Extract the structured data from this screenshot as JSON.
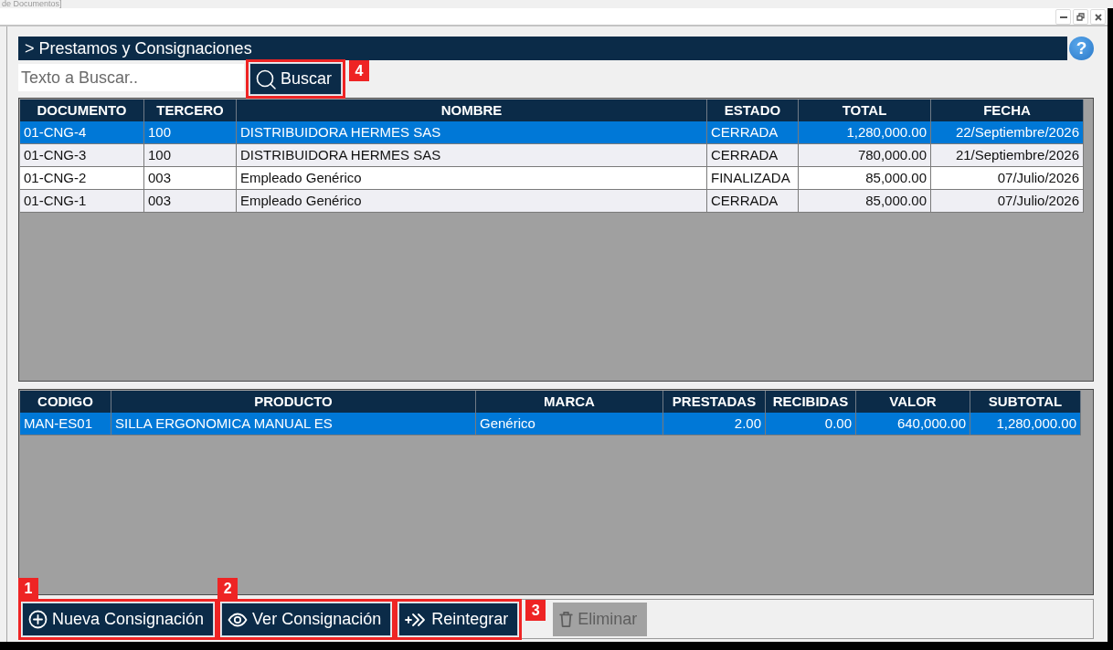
{
  "window": {
    "title": "de Documentos]"
  },
  "panel": {
    "title": "> Prestamos y Consignaciones",
    "help": "?"
  },
  "search": {
    "placeholder": "Texto a Buscar..",
    "button": {
      "label": "Buscar",
      "callout": {
        "number": "4",
        "above": false
      }
    }
  },
  "documents": {
    "columns": [
      {
        "label": "DOCUMENTO",
        "kind": "text"
      },
      {
        "label": "TERCERO",
        "kind": "text"
      },
      {
        "label": "NOMBRE",
        "kind": "text"
      },
      {
        "label": "ESTADO",
        "kind": "text"
      },
      {
        "label": "TOTAL",
        "kind": "number"
      },
      {
        "label": "FECHA",
        "kind": "date"
      }
    ],
    "rows": [
      {
        "selected": true,
        "cells": [
          "01-CNG-4",
          "100",
          "DISTRIBUIDORA HERMES SAS",
          "CERRADA",
          "1,280,000.00",
          "22/Septiembre/2026"
        ]
      },
      {
        "selected": false,
        "cells": [
          "01-CNG-3",
          "100",
          "DISTRIBUIDORA HERMES SAS",
          "CERRADA",
          "780,000.00",
          "21/Septiembre/2026"
        ]
      },
      {
        "selected": false,
        "cells": [
          "01-CNG-2",
          "003",
          "Empleado Genérico",
          "FINALIZADA",
          "85,000.00",
          "07/Julio/2026"
        ]
      },
      {
        "selected": false,
        "cells": [
          "01-CNG-1",
          "003",
          "Empleado Genérico",
          "CERRADA",
          "85,000.00",
          "07/Julio/2026"
        ]
      }
    ]
  },
  "products": {
    "columns": [
      {
        "label": "CODIGO",
        "kind": "text"
      },
      {
        "label": "PRODUCTO",
        "kind": "text"
      },
      {
        "label": "MARCA",
        "kind": "text"
      },
      {
        "label": "PRESTADAS",
        "kind": "number"
      },
      {
        "label": "RECIBIDAS",
        "kind": "number"
      },
      {
        "label": "VALOR",
        "kind": "number"
      },
      {
        "label": "SUBTOTAL",
        "kind": "number"
      }
    ],
    "rows": [
      {
        "selected": true,
        "cells": [
          "MAN-ES01",
          "SILLA ERGONOMICA MANUAL ES",
          "Genérico",
          "2.00",
          "0.00",
          "640,000.00",
          "1,280,000.00"
        ]
      }
    ]
  },
  "actions": [
    {
      "label": "Nueva Consignación",
      "kind": "add",
      "disabled": false,
      "callout": {
        "number": "1",
        "above": true
      }
    },
    {
      "label": "Ver Consignación",
      "kind": "view",
      "disabled": false,
      "callout": {
        "number": "2",
        "above": true
      }
    },
    {
      "label": "Reintegrar",
      "kind": "reintegrate",
      "disabled": false,
      "callout": {
        "number": "3",
        "above": false
      }
    },
    {
      "label": "Eliminar",
      "kind": "delete",
      "disabled": true
    }
  ]
}
